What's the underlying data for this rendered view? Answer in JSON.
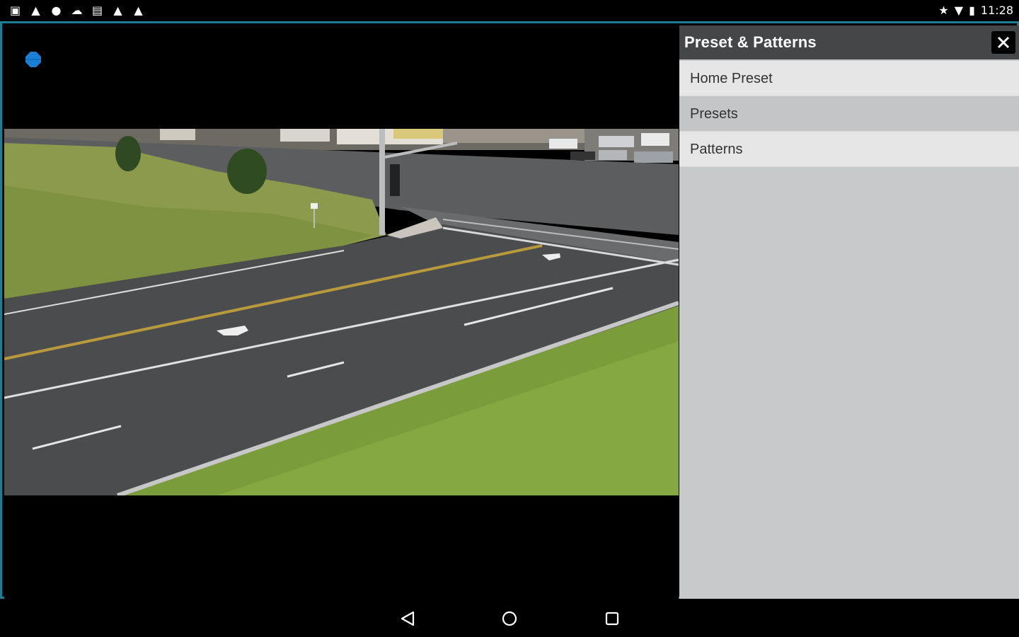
{
  "status_bar": {
    "left_icons": [
      "sim-icon",
      "warning-icon",
      "location-icon",
      "cloud-icon",
      "gallery-icon",
      "warning-icon",
      "warning-icon"
    ],
    "right_icons": [
      "star-icon",
      "wifi-icon",
      "battery-icon"
    ],
    "time": "11:28"
  },
  "panel": {
    "title": "Preset & Patterns",
    "close_label": "✕",
    "items": [
      {
        "label": "Home Preset"
      },
      {
        "label": "Presets"
      },
      {
        "label": "Patterns"
      }
    ]
  },
  "colors": {
    "frame_border": "#1d7d93",
    "panel_header": "#454648",
    "panel_bg": "#c8c9cb",
    "ptz_dot": "#1a7fd6"
  }
}
